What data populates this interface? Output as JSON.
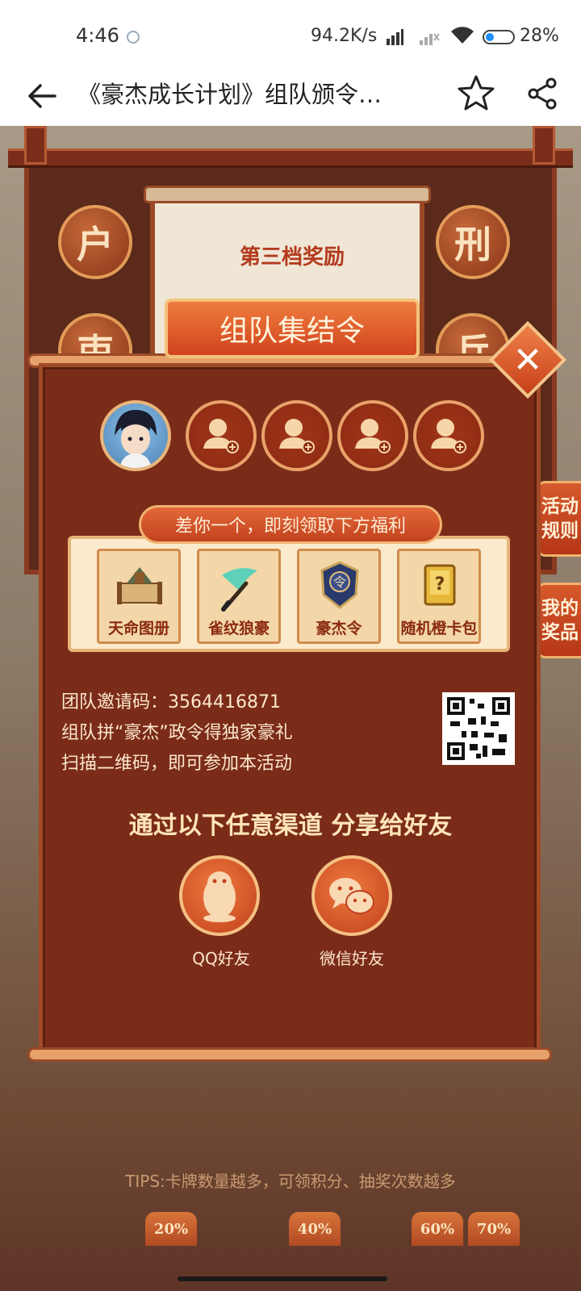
{
  "status_bar": {
    "time": "4:46",
    "network_speed": "94.2K/s",
    "battery": "28%"
  },
  "toolbar": {
    "title": "《豪杰成长计划》组队颁令…"
  },
  "background": {
    "seals": [
      "户",
      "刑",
      "吏",
      "兵"
    ],
    "scroll_heading": "第三档奖励",
    "side_tabs": [
      "活动规则",
      "我的奖品"
    ]
  },
  "modal": {
    "title": "组队集结令",
    "benefit_text": "差你一个，即刻领取下方福利",
    "rewards": [
      {
        "label": "天命图册",
        "icon": "scroll-book-icon"
      },
      {
        "label": "雀纹狼豪",
        "icon": "brush-icon"
      },
      {
        "label": "豪杰令",
        "icon": "token-icon"
      },
      {
        "label": "随机橙卡包",
        "icon": "mystery-card-icon"
      }
    ],
    "invite_code_label": "团队邀请码：",
    "invite_code": "3564416871",
    "info_line_1": "组队拼“豪杰”政令得独家豪礼",
    "info_line_2": "扫描二维码，即可参加本活动",
    "share_heading": "通过以下任意渠道  分享给好友",
    "share_options": [
      {
        "label": "QQ好友",
        "icon": "qq-penguin-icon"
      },
      {
        "label": "微信好友",
        "icon": "wechat-icon"
      }
    ]
  },
  "tips": "TIPS:卡牌数量越多，可领积分、抽奖次数越多",
  "progress_markers": [
    "20%",
    "40%",
    "60%",
    "70%"
  ],
  "colors": {
    "modal_bg": "#7b2c19",
    "accent": "#d1441e",
    "gold": "#f4c27a"
  }
}
